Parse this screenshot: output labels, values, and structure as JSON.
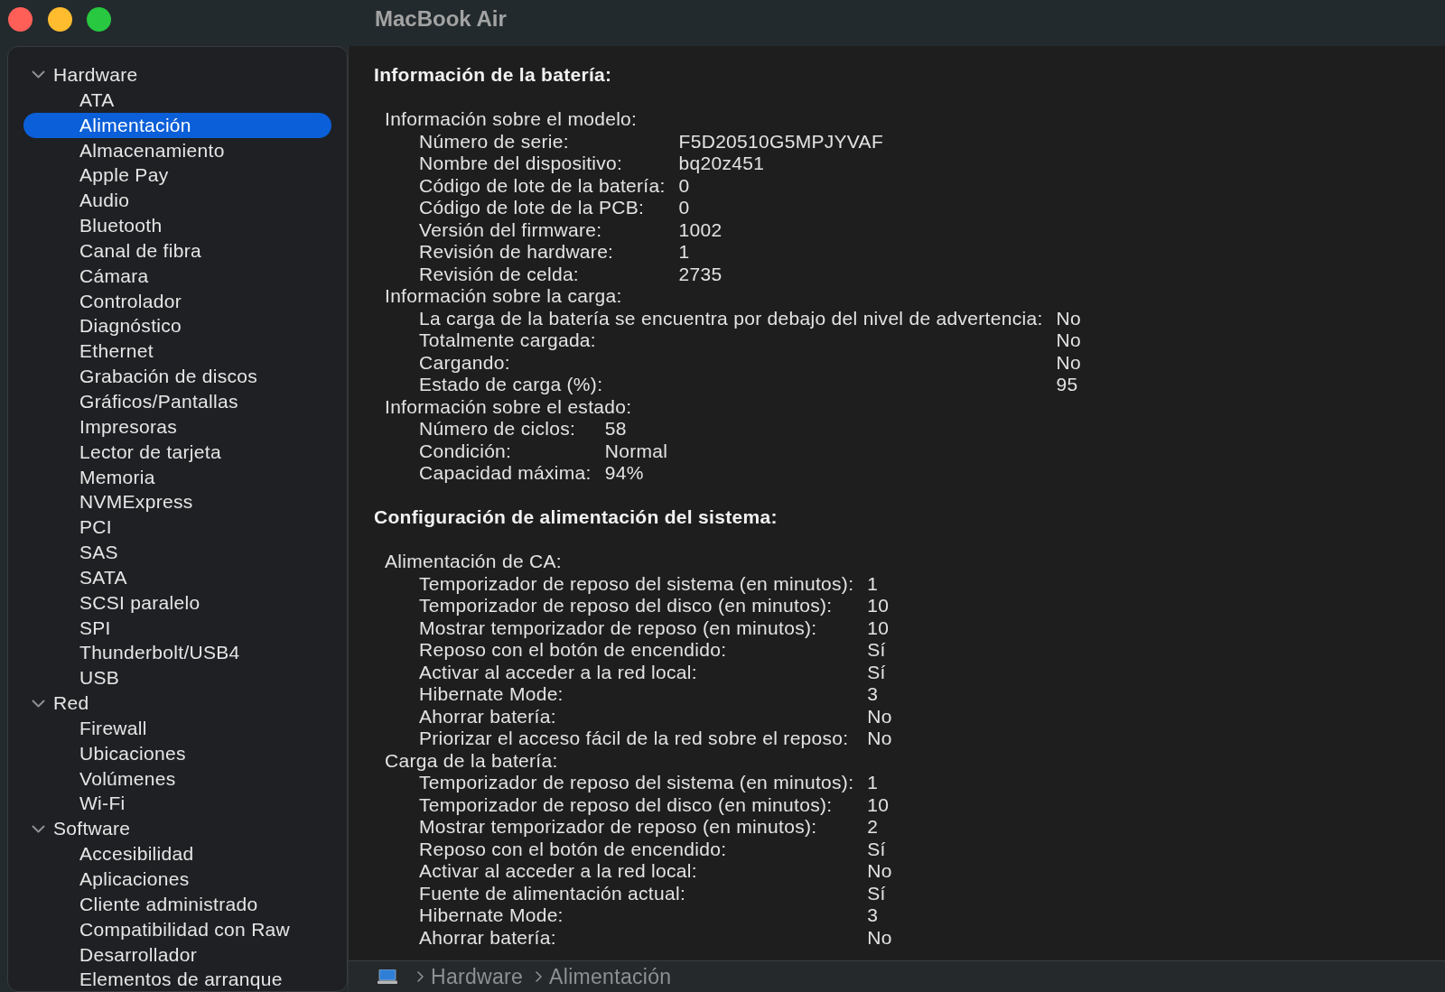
{
  "window": {
    "title": "MacBook Air"
  },
  "sidebar": {
    "sections": [
      {
        "label": "Hardware",
        "expanded": true,
        "children": [
          {
            "label": "ATA",
            "selected": false
          },
          {
            "label": "Alimentación",
            "selected": true
          },
          {
            "label": "Almacenamiento",
            "selected": false
          },
          {
            "label": "Apple Pay",
            "selected": false
          },
          {
            "label": "Audio",
            "selected": false
          },
          {
            "label": "Bluetooth",
            "selected": false
          },
          {
            "label": "Canal de fibra",
            "selected": false
          },
          {
            "label": "Cámara",
            "selected": false
          },
          {
            "label": "Controlador",
            "selected": false
          },
          {
            "label": "Diagnóstico",
            "selected": false
          },
          {
            "label": "Ethernet",
            "selected": false
          },
          {
            "label": "Grabación de discos",
            "selected": false
          },
          {
            "label": "Gráficos/Pantallas",
            "selected": false
          },
          {
            "label": "Impresoras",
            "selected": false
          },
          {
            "label": "Lector de tarjeta",
            "selected": false
          },
          {
            "label": "Memoria",
            "selected": false
          },
          {
            "label": "NVMExpress",
            "selected": false
          },
          {
            "label": "PCI",
            "selected": false
          },
          {
            "label": "SAS",
            "selected": false
          },
          {
            "label": "SATA",
            "selected": false
          },
          {
            "label": "SCSI paralelo",
            "selected": false
          },
          {
            "label": "SPI",
            "selected": false
          },
          {
            "label": "Thunderbolt/USB4",
            "selected": false
          },
          {
            "label": "USB",
            "selected": false
          }
        ]
      },
      {
        "label": "Red",
        "expanded": true,
        "children": [
          {
            "label": "Firewall",
            "selected": false
          },
          {
            "label": "Ubicaciones",
            "selected": false
          },
          {
            "label": "Volúmenes",
            "selected": false
          },
          {
            "label": "Wi-Fi",
            "selected": false
          }
        ]
      },
      {
        "label": "Software",
        "expanded": true,
        "children": [
          {
            "label": "Accesibilidad",
            "selected": false
          },
          {
            "label": "Aplicaciones",
            "selected": false
          },
          {
            "label": "Cliente administrado",
            "selected": false
          },
          {
            "label": "Compatibilidad con Raw",
            "selected": false
          },
          {
            "label": "Desarrollador",
            "selected": false
          },
          {
            "label": "Elementos de arranque",
            "selected": false
          }
        ]
      }
    ]
  },
  "content": {
    "sections": [
      {
        "title": "Información de la batería:",
        "groups": [
          {
            "label": "Información sobre el modelo:",
            "rows": [
              {
                "label": "Número de serie:",
                "value": "F5D20510G5MPJYVAF"
              },
              {
                "label": "Nombre del dispositivo:",
                "value": "bq20z451"
              },
              {
                "label": "Código de lote de la batería:",
                "value": "0"
              },
              {
                "label": "Código de lote de la PCB:",
                "value": "0"
              },
              {
                "label": "Versión del firmware:",
                "value": "1002"
              },
              {
                "label": "Revisión de hardware:",
                "value": "1"
              },
              {
                "label": "Revisión de celda:",
                "value": "2735"
              }
            ]
          },
          {
            "label": "Información sobre la carga:",
            "rows": [
              {
                "label": "La carga de la batería se encuentra por debajo del nivel de advertencia:",
                "value": "No"
              },
              {
                "label": "Totalmente cargada:",
                "value": "No"
              },
              {
                "label": "Cargando:",
                "value": "No"
              },
              {
                "label": "Estado de carga (%):",
                "value": "95"
              }
            ]
          },
          {
            "label": "Información sobre el estado:",
            "rows": [
              {
                "label": "Número de ciclos:",
                "value": "58"
              },
              {
                "label": "Condición:",
                "value": "Normal"
              },
              {
                "label": "Capacidad máxima:",
                "value": "94%"
              }
            ]
          }
        ]
      },
      {
        "title": "Configuración de alimentación del sistema:",
        "groups": [
          {
            "label": "Alimentación de CA:",
            "rows": [
              {
                "label": "Temporizador de reposo del sistema (en minutos):",
                "value": "1"
              },
              {
                "label": "Temporizador de reposo del disco (en minutos):",
                "value": "10"
              },
              {
                "label": "Mostrar temporizador de reposo (en minutos):",
                "value": "10"
              },
              {
                "label": "Reposo con el botón de encendido:",
                "value": "Sí"
              },
              {
                "label": "Activar al acceder a la red local:",
                "value": "Sí"
              },
              {
                "label": "Hibernate Mode:",
                "value": "3"
              },
              {
                "label": "Ahorrar batería:",
                "value": "No"
              },
              {
                "label": "Priorizar el acceso fácil de la red sobre el reposo:",
                "value": "No"
              }
            ]
          },
          {
            "label": "Carga de la batería:",
            "rows": [
              {
                "label": "Temporizador de reposo del sistema (en minutos):",
                "value": "1"
              },
              {
                "label": "Temporizador de reposo del disco (en minutos):",
                "value": "10"
              },
              {
                "label": "Mostrar temporizador de reposo (en minutos):",
                "value": "2"
              },
              {
                "label": "Reposo con el botón de encendido:",
                "value": "Sí"
              },
              {
                "label": "Activar al acceder a la red local:",
                "value": "No"
              },
              {
                "label": "Fuente de alimentación actual:",
                "value": "Sí"
              },
              {
                "label": "Hibernate Mode:",
                "value": "3"
              },
              {
                "label": "Ahorrar batería:",
                "value": "No"
              }
            ]
          }
        ]
      }
    ]
  },
  "status_bar": {
    "path": [
      "Hardware",
      "Alimentación"
    ]
  }
}
